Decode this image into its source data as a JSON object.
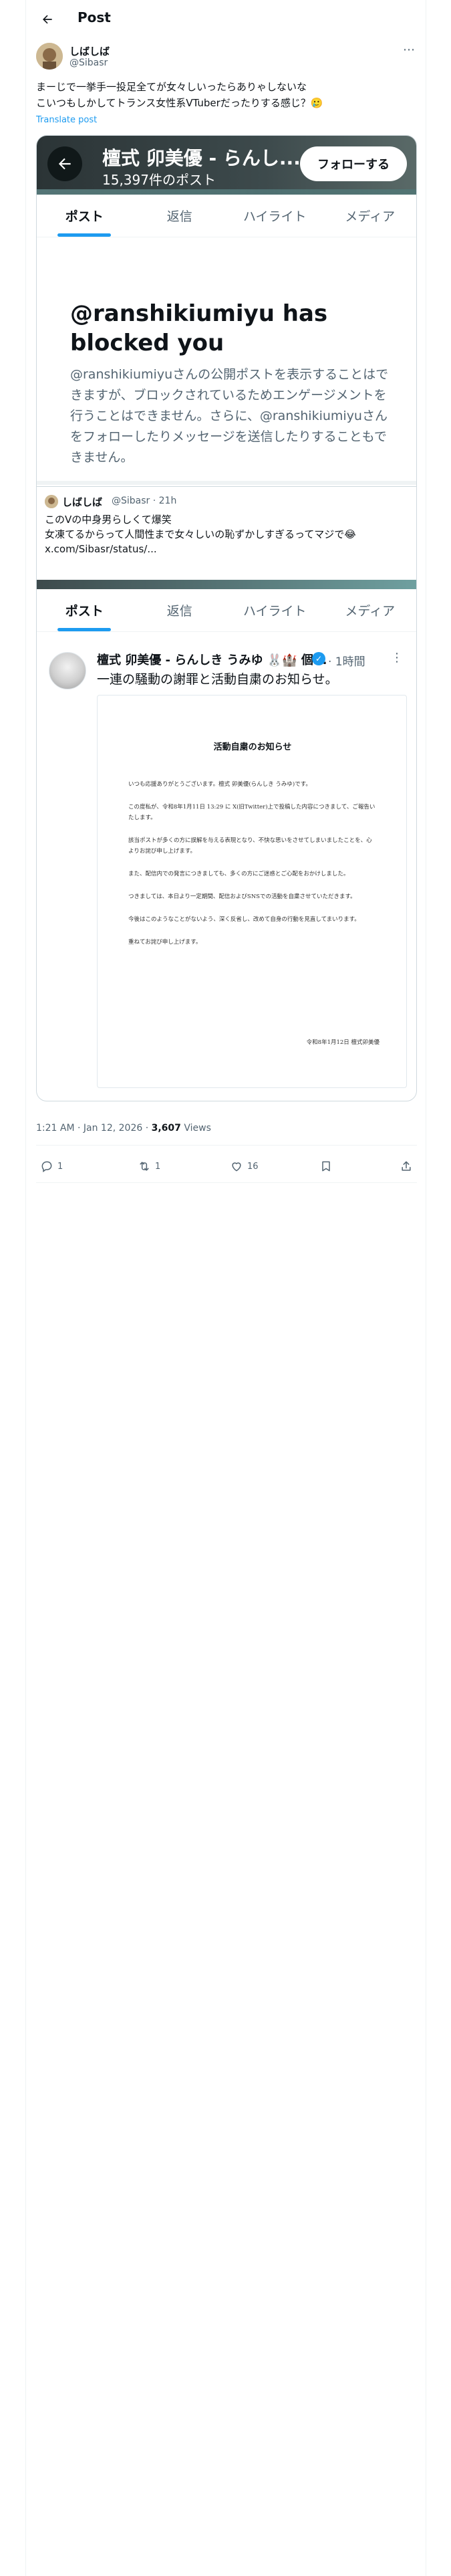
{
  "header": {
    "title": "Post"
  },
  "tweet": {
    "author_name": "しばしば",
    "author_handle": "@Sibasr",
    "text": "まーじで一挙手一投足全てが女々しいったらありゃしないな\nこいつもしかしてトランス女性系VTuberだったりする感じ？🥲",
    "translate_label": "Translate post",
    "timestamp": "1:21 AM · Jan 12, 2026 · ",
    "views_count": "3,607",
    "views_label": " Views"
  },
  "blocked_profile": {
    "name": "檀式 卯美優 - らんし...",
    "post_count": "15,397件のポスト",
    "follow_label": "フォローする",
    "tabs": [
      "ポスト",
      "返信",
      "ハイライト",
      "メディア"
    ],
    "block_title": "@ranshikiumiyu has blocked you",
    "block_body": "@ranshikiumiyuさんの公開ポストを表示することはできますが、ブロックされているためエンゲージメントを行うことはできません。さらに、@ranshikiumiyuさんをフォローしたりメッセージを送信したりすることもできません。"
  },
  "quoted": {
    "name": "しばしば",
    "meta": "@Sibasr · 21h",
    "text": "このVの中身男らしくて爆笑\n女凍てるからって人間性まで女々しいの恥ずかしすぎるってマジで😂\nx.com/Sibasr/status/..."
  },
  "profile_tabs": [
    "ポスト",
    "返信",
    "ハイライト",
    "メディア"
  ],
  "repost": {
    "name": "檀式 卯美優 - らんしき うみゆ 🐰🏰 個...",
    "time": "· 1時間",
    "text": "一連の騒動の謝罪と活動自粛のお知らせ。",
    "verified_glyph": "✓"
  },
  "document": {
    "title": "活動自粛のお知らせ",
    "paragraphs": [
      "いつも応援ありがとうございます。檀式 卯美優(らんしき うみゆ)です。",
      "この度私が、令和8年1月11日 13:29 に X(旧Twitter)上で投稿した内容につきまして、ご報告いたします。",
      "該当ポストが多くの方に誤解を与える表現となり、不快な思いをさせてしまいましたことを、心よりお詫び申し上げます。",
      "また、配信内での発言につきましても、多くの方にご迷惑とご心配をおかけしました。",
      "つきましては、本日より一定期間、配信およびSNSでの活動を自粛させていただきます。",
      "今後はこのようなことがないよう、深く反省し、改めて自身の行動を見直してまいります。",
      "重ねてお詫び申し上げます。"
    ],
    "signature": "令和8年1月12日 檀式卯美優"
  },
  "actions": {
    "reply_count": "1",
    "repost_count": "1",
    "like_count": "16"
  }
}
